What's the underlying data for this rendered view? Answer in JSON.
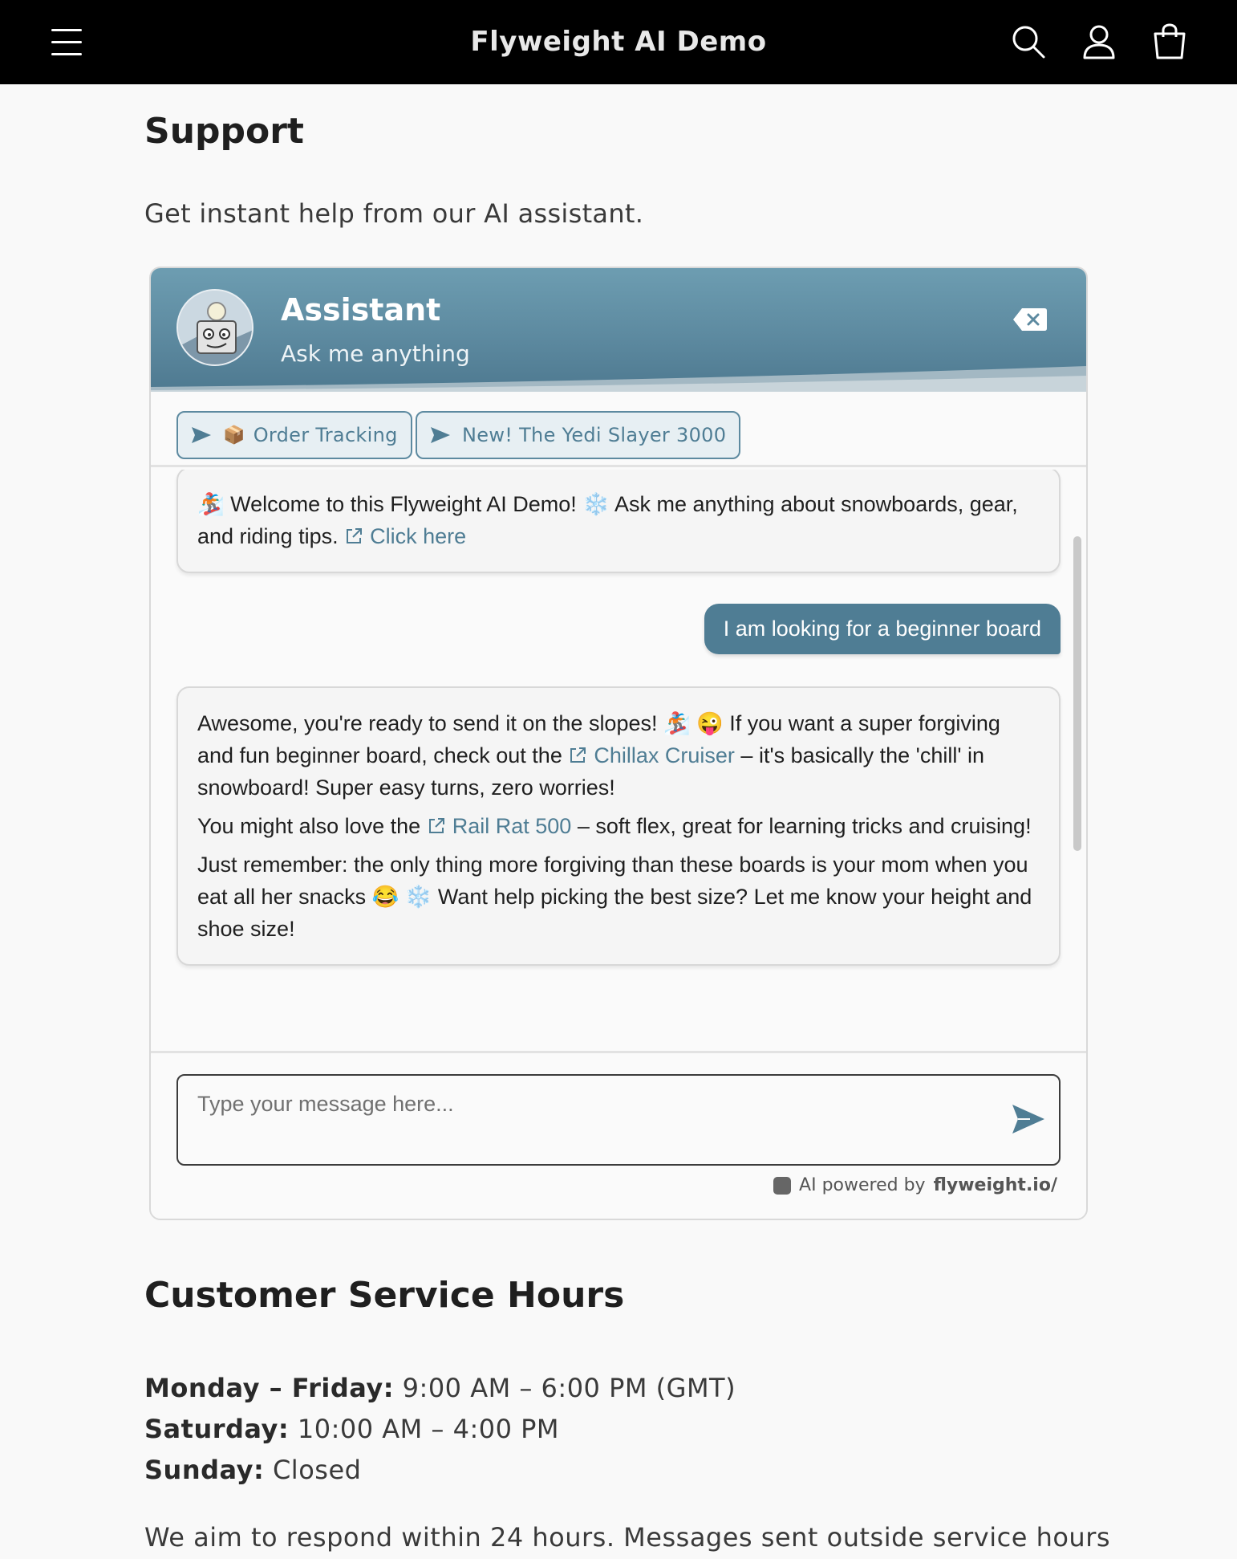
{
  "header": {
    "title": "Flyweight AI Demo",
    "icons": [
      "menu-icon",
      "search-icon",
      "account-icon",
      "cart-icon"
    ]
  },
  "page": {
    "title": "Support",
    "subtitle": "Get instant help from our AI assistant."
  },
  "chat": {
    "title": "Assistant",
    "subtitle": "Ask me anything",
    "accent": "#5d8aa0",
    "chips": [
      {
        "emoji": "📦",
        "label": "Order Tracking"
      },
      {
        "label": "New! The Yedi Slayer 3000"
      }
    ],
    "welcome": {
      "emoji1": "🏂",
      "text": "Welcome to this Flyweight AI Demo!",
      "emoji2": "❄️",
      "text2": "Ask me anything about snowboards, gear, and riding tips.",
      "link": "Click here"
    },
    "user_message": "I am looking for a beginner board",
    "reply": {
      "p1_a": "Awesome, you're ready to send it on the slopes! 🏂 😜  If you want a super forgiving and fun beginner board, check out the",
      "p1_link": "Chillax Cruiser",
      "p1_b": "– it's basically the 'chill' in snowboard! Super easy turns, zero worries!",
      "p2_a": "You might also love the",
      "p2_link": "Rail Rat 500",
      "p2_b": "– soft flex, great for learning tricks and cruising!",
      "p3": "Just remember: the only thing more forgiving than these boards is your mom when you eat all her snacks 😂 ❄️  Want help picking the best size? Let me know your height and shoe size!"
    },
    "input_placeholder": "Type your message here...",
    "powered_label": "AI powered by",
    "powered_brand": "flyweight.io/"
  },
  "hours": {
    "title": "Customer Service Hours",
    "rows": [
      {
        "day": "Monday – Friday:",
        "time": "9:00 AM – 6:00 PM (GMT)"
      },
      {
        "day": "Saturday:",
        "time": "10:00 AM – 4:00 PM"
      },
      {
        "day": "Sunday:",
        "time": "Closed"
      }
    ],
    "note": "We aim to respond within 24 hours. Messages sent outside service hours"
  }
}
